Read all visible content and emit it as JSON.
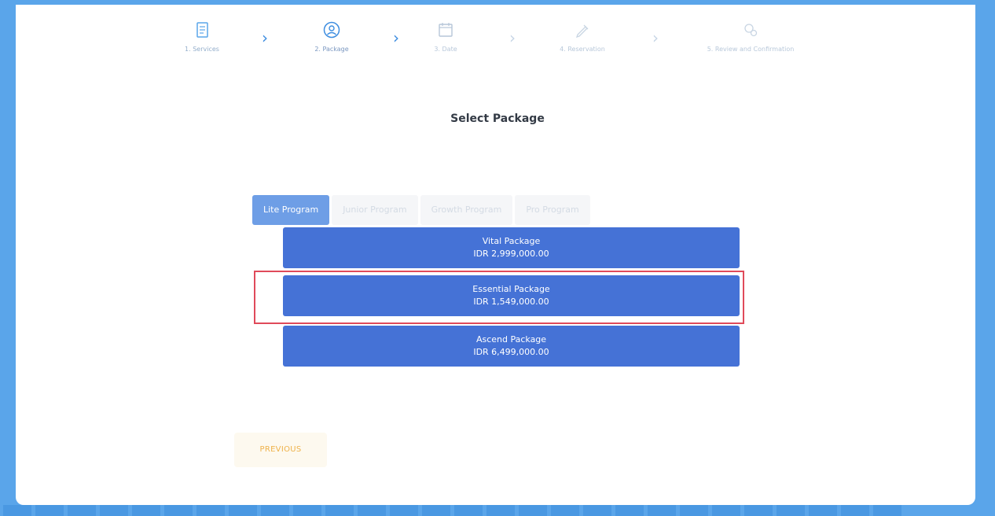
{
  "stepper": {
    "steps": [
      {
        "label": "1. Services",
        "icon": "services-book-icon",
        "state": "done"
      },
      {
        "label": "2. Package",
        "icon": "package-user-icon",
        "state": "active"
      },
      {
        "label": "3. Date",
        "icon": "calendar-icon",
        "state": "pending"
      },
      {
        "label": "4. Reservation",
        "icon": "pencil-icon",
        "state": "pending"
      },
      {
        "label": "5. Review and Confirmation",
        "icon": "gears-icon",
        "state": "pending"
      }
    ]
  },
  "page_title": "Select Package",
  "tabs": [
    {
      "label": "Lite Program",
      "active": true
    },
    {
      "label": "Junior Program",
      "active": false
    },
    {
      "label": "Growth Program",
      "active": false
    },
    {
      "label": "Pro Program",
      "active": false
    }
  ],
  "packages": [
    {
      "name": "Vital Package",
      "price": "IDR 2,999,000.00"
    },
    {
      "name": "Essential Package",
      "price": "IDR 1,549,000.00"
    },
    {
      "name": "Ascend Package",
      "price": "IDR 6,499,000.00"
    }
  ],
  "previous_label": "PREVIOUS",
  "colors": {
    "accent": "#4572d6",
    "tab_active": "#6e9ee6",
    "highlight": "#e04a5a",
    "previous_text": "#efb24a",
    "frame": "#5aa5ea"
  }
}
